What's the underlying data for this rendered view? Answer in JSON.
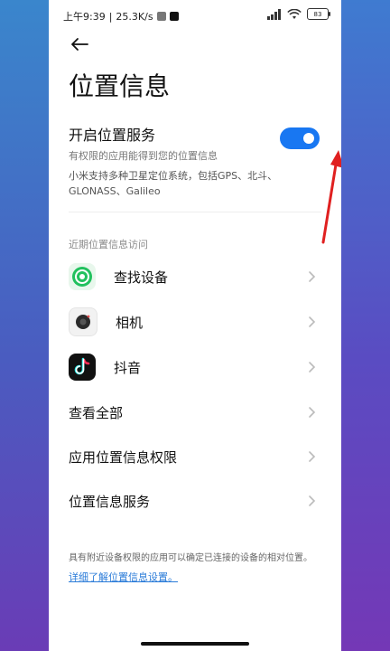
{
  "status_bar": {
    "time": "上午9:39",
    "speed": "25.3K/s",
    "battery": "83"
  },
  "page": {
    "title": "位置信息"
  },
  "location_service": {
    "title": "开启位置服务",
    "subtitle": "有权限的应用能得到您的位置信息",
    "toggle_state": "on",
    "description": "小米支持多种卫星定位系统，包括GPS、北斗、GLONASS、Galileo"
  },
  "recent_access": {
    "header": "近期位置信息访问",
    "apps": [
      {
        "label": "查找设备",
        "icon": "find-device-icon"
      },
      {
        "label": "相机",
        "icon": "camera-icon"
      },
      {
        "label": "抖音",
        "icon": "douyin-icon"
      }
    ]
  },
  "menu": [
    {
      "label": "查看全部"
    },
    {
      "label": "应用位置信息权限"
    },
    {
      "label": "位置信息服务"
    }
  ],
  "footer": {
    "note": "具有附近设备权限的应用可以确定已连接的设备的相对位置。",
    "link": "详细了解位置信息设置。"
  },
  "colors": {
    "accent": "#1877f2",
    "link": "#2a7bd8",
    "annotation": "#e02020"
  }
}
